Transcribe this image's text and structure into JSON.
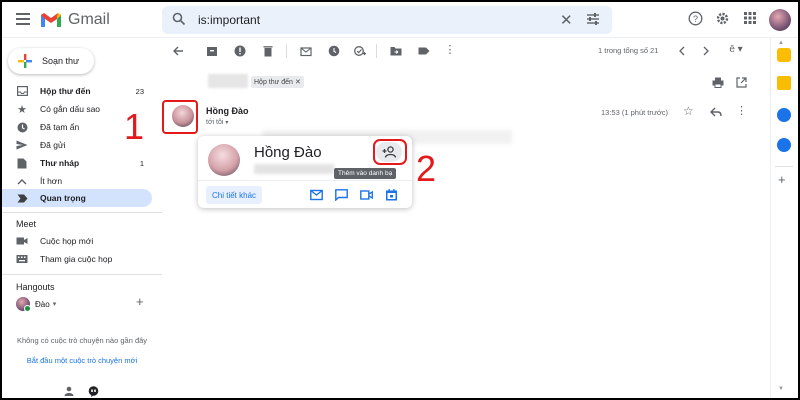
{
  "header": {
    "app_name": "Gmail",
    "search_value": "is:important"
  },
  "sidebar": {
    "compose_label": "Soạn thư",
    "items": [
      {
        "label": "Hộp thư đến",
        "count": "23",
        "bold": true
      },
      {
        "label": "Có gắn dấu sao",
        "count": "",
        "bold": false
      },
      {
        "label": "Đã tạm ẩn",
        "count": "",
        "bold": false
      },
      {
        "label": "Đã gửi",
        "count": "",
        "bold": false
      },
      {
        "label": "Thư nháp",
        "count": "1",
        "bold": true
      },
      {
        "label": "Ít hơn",
        "count": "",
        "bold": false
      },
      {
        "label": "Quan trọng",
        "count": "",
        "bold": false,
        "active": true
      }
    ],
    "meet_title": "Meet",
    "meet_items": [
      "Cuộc họp mới",
      "Tham gia cuộc họp"
    ],
    "hangouts_title": "Hangouts",
    "hangouts_user": "Đào",
    "no_chat_text": "Không có cuộc trò chuyện nào gần đây",
    "start_chat_link": "Bắt đầu một cuộc trò chuyện mới"
  },
  "toolbar": {
    "pager_text": "1 trong tổng số 21"
  },
  "message": {
    "label_chip": "Hộp thư đến",
    "sender": "Hồng Đào",
    "to_me": "tới tôi",
    "time": "13:53 (1 phút trước)"
  },
  "hovercard": {
    "name": "Hồng Đào",
    "tooltip": "Thêm vào danh bạ",
    "details_button": "Chi tiết khác"
  },
  "annotations": {
    "step1": "1",
    "step2": "2",
    "color": "#e3191c"
  },
  "colors": {
    "accent": "#1a73e8",
    "active_nav": "#d3e3fd",
    "search_bg": "#eaf1fb"
  }
}
